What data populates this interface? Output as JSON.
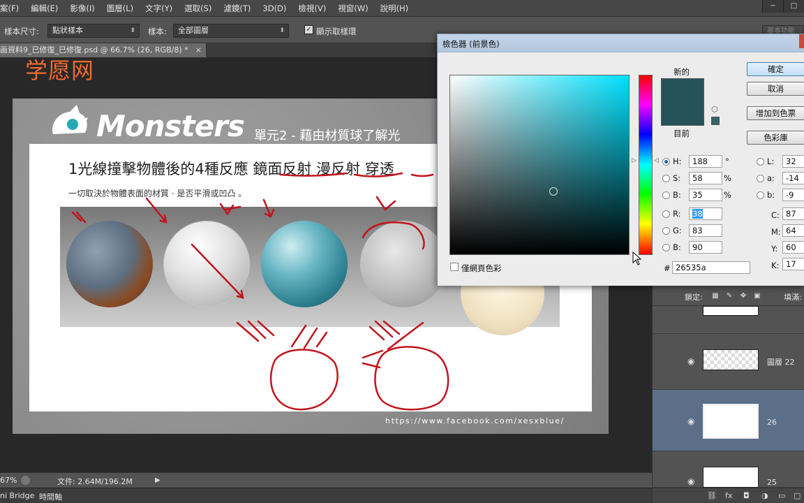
{
  "menu": [
    "案(F)",
    "編輯(E)",
    "影像(I)",
    "圖層(L)",
    "文字(Y)",
    "選取(S)",
    "濾鏡(T)",
    "3D(D)",
    "檢視(V)",
    "視窗(W)",
    "說明(H)"
  ],
  "options": {
    "sample_size_label": "樣本尺寸:",
    "sample_size_value": "點狀樣本",
    "sample_label": "樣本:",
    "sample_value": "全部圖層",
    "show_ring_label": "顯示取樣環",
    "workspace": "基本功能"
  },
  "document_tab": {
    "title": "画資料9_已修復_已修復.psd @ 66.7% (26, RGB/8) *",
    "close": "×"
  },
  "watermark": "学愿网",
  "artwork": {
    "brand": "Monsters",
    "unit_title": "單元2 - 藉由材質球了解光",
    "heading": "1光線撞擊物體後的4種反應 鏡面反射 漫反射 穿透",
    "subline": "一切取決於物體表面的材質 · 是否平滑或凹凸 。",
    "url": "https://www.facebook.com/xesxblue/",
    "accent_color": "#c0141c"
  },
  "status": {
    "zoom": "67%",
    "doc_info": "文件: 2.64M/196.2M"
  },
  "bottom_tabs": [
    "ni Bridge",
    "時間軸"
  ],
  "layers": {
    "lock_label": "鎖定:",
    "fill_label": "填滿:",
    "items": [
      {
        "name": ""
      },
      {
        "name": "圖層 22"
      },
      {
        "name": "26"
      },
      {
        "name": "25"
      }
    ]
  },
  "color_picker": {
    "title": "檢色器 (前景色)",
    "new_label": "新的",
    "current_label": "目前",
    "new_color": "#26535a",
    "buttons": {
      "ok": "確定",
      "cancel": "取消",
      "add_swatch": "增加到色票",
      "libraries": "色彩庫"
    },
    "hsb": [
      {
        "label": "H:",
        "value": "188",
        "unit": "°"
      },
      {
        "label": "S:",
        "value": "58",
        "unit": "%"
      },
      {
        "label": "B:",
        "value": "35",
        "unit": "%"
      }
    ],
    "rgb": [
      {
        "label": "R:",
        "value": "38"
      },
      {
        "label": "G:",
        "value": "83"
      },
      {
        "label": "B:",
        "value": "90"
      }
    ],
    "lab": [
      {
        "label": "L:",
        "value": "32"
      },
      {
        "label": "a:",
        "value": "-14"
      },
      {
        "label": "b:",
        "value": "-9"
      }
    ],
    "cmyk": [
      {
        "label": "C:",
        "value": "87"
      },
      {
        "label": "M:",
        "value": "64"
      },
      {
        "label": "Y:",
        "value": "60"
      },
      {
        "label": "K:",
        "value": "17"
      }
    ],
    "hex_label": "#",
    "hex": "26535a",
    "web_only_label": "僅網頁色彩"
  }
}
